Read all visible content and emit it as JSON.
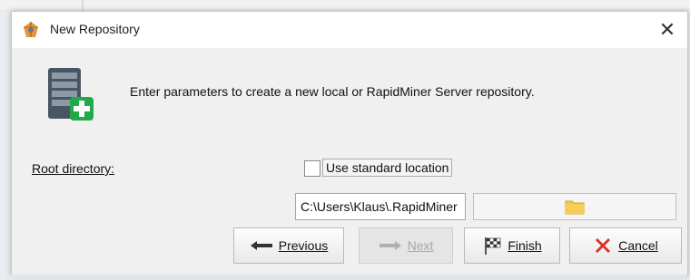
{
  "window": {
    "title": "New Repository",
    "close_glyph": "✕",
    "app_icon": "rapidminer-logo-icon"
  },
  "header": {
    "icon": "server-add-icon",
    "description": "Enter parameters to create a new local or RapidMiner Server repository."
  },
  "form": {
    "root_directory_label": "Root directory:",
    "use_standard_location": {
      "label": "Use standard location",
      "checked": false
    },
    "path_value": "C:\\Users\\Klaus\\.RapidMiner",
    "browse_icon": "folder-icon"
  },
  "buttons": {
    "previous": {
      "label": "Previous",
      "icon": "arrow-left-icon",
      "enabled": true
    },
    "next": {
      "label": "Next",
      "icon": "arrow-right-icon",
      "enabled": false
    },
    "finish": {
      "label": "Finish",
      "icon": "checkered-flag-icon",
      "enabled": true
    },
    "cancel": {
      "label": "Cancel",
      "icon": "red-x-icon",
      "enabled": true
    }
  },
  "colors": {
    "cancel_red": "#d93025",
    "folder_yellow": "#f5c342",
    "accent_green": "#21a94a"
  }
}
